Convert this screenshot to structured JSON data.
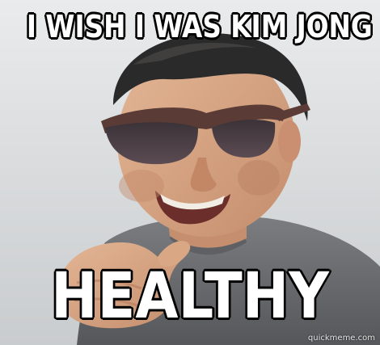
{
  "caption": {
    "top": "I WISH I WAS KIM JONG",
    "bottom": "HEALTHY"
  },
  "watermark": "quickmeme.com",
  "colors": {
    "caption_text": "#ffffff",
    "caption_outline": "#000000",
    "background": "#d8dbdc",
    "jacket": "#6f7174",
    "skin": "#d7a582",
    "hair": "#2b2a2a",
    "glasses_frame": "#5a3b35",
    "lenses": "#2f2b2e"
  },
  "image": {
    "subject": "man-with-sunglasses-thumb-gesture"
  }
}
